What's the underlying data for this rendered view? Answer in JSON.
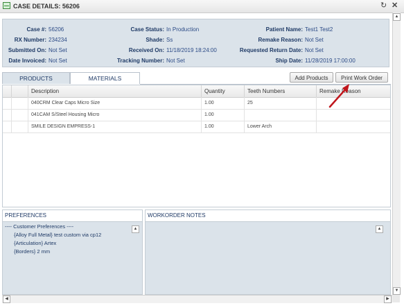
{
  "window": {
    "title": "CASE DETAILS: 56206"
  },
  "header": {
    "col1": [
      {
        "label": "Case #:",
        "value": "56206"
      },
      {
        "label": "RX Number:",
        "value": "234234"
      },
      {
        "label": "Submitted On:",
        "value": "Not Set"
      },
      {
        "label": "Date Invoiced:",
        "value": "Not Set"
      }
    ],
    "col2": [
      {
        "label": "Case Status:",
        "value": "In Production"
      },
      {
        "label": "Shade:",
        "value": "Ss"
      },
      {
        "label": "Received On:",
        "value": "11/18/2019 18:24:00"
      },
      {
        "label": "Tracking Number:",
        "value": "Not Set"
      }
    ],
    "col3": [
      {
        "label": "Patient Name:",
        "value": "Test1 Test2"
      },
      {
        "label": "Remake Reason:",
        "value": "Not Set"
      },
      {
        "label": "Requested Return Date:",
        "value": "Not Set"
      },
      {
        "label": "Ship Date:",
        "value": "11/28/2019 17:00:00"
      }
    ]
  },
  "tabs": [
    {
      "label": "PRODUCTS",
      "active": false
    },
    {
      "label": "MATERIALS",
      "active": true
    }
  ],
  "toolbar": {
    "add_products": "Add Products",
    "print_work_order": "Print Work Order"
  },
  "table": {
    "columns": [
      "Description",
      "Quantity",
      "Teeth Numbers",
      "Remake Reason"
    ],
    "rows": [
      {
        "description": "040CRM Clear Caps Micro Size",
        "quantity": "1.00",
        "teeth": "25",
        "remake": ""
      },
      {
        "description": "041CAM S/Steel Housing Micro",
        "quantity": "1.00",
        "teeth": "",
        "remake": ""
      },
      {
        "description": "SMILE DESIGN EMPRESS-1",
        "quantity": "1.00",
        "teeth": "Lower Arch",
        "remake": ""
      }
    ]
  },
  "preferences": {
    "title": "PREFERENCES",
    "lines": [
      "---- Customer Preferences ----",
      "{Alloy Full Metal} test custom via cp12",
      "{Articulation} Artex",
      "{Borders} 2 mm"
    ]
  },
  "workorder_notes": {
    "title": "WORKORDER NOTES"
  },
  "icons": {
    "app": "case-window-icon",
    "refresh": "refresh-icon",
    "close": "close-icon",
    "annotation": "red-arrow-pointer"
  },
  "colors": {
    "panel_bg": "#dbe3ea",
    "text": "#1f3a66",
    "arrow": "#c0161c"
  }
}
